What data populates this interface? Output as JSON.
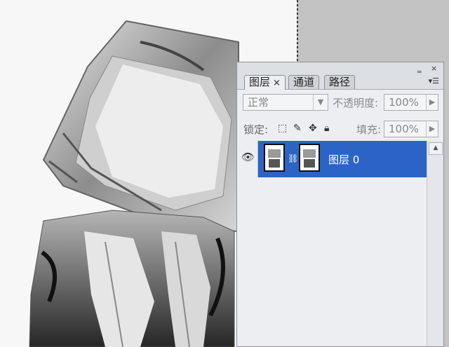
{
  "panel": {
    "tabs": [
      {
        "label": "图层",
        "close": "×"
      },
      {
        "label": "通道"
      },
      {
        "label": "路径"
      }
    ],
    "controls": {
      "minimize": "‗",
      "close": "×",
      "menu": "▾☰"
    },
    "blend_mode": "正常",
    "opacity_label": "不透明度:",
    "opacity_value": "100%",
    "lock_label": "锁定:",
    "fill_label": "填充:",
    "fill_value": "100%",
    "lock_icons": [
      "lock-transparent-icon",
      "brush-icon",
      "move-icon",
      "lock-icon"
    ],
    "layers": [
      {
        "name": "图层 0",
        "visible": true,
        "selected": true
      }
    ]
  },
  "colors": {
    "selected": "#2b64c4",
    "panel_bg": "#eceef1",
    "workspace": "#c3c3c3"
  }
}
